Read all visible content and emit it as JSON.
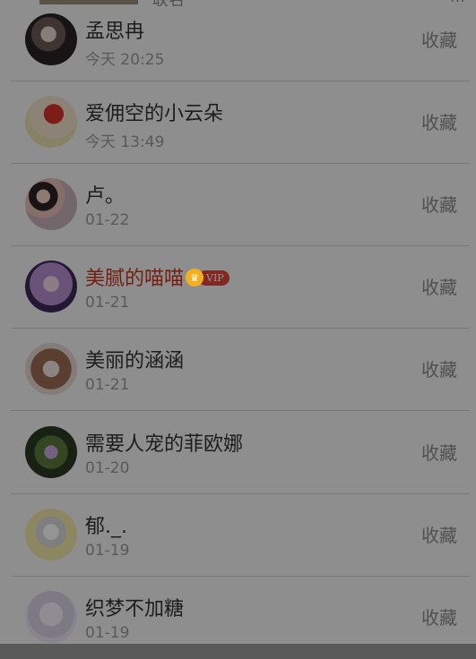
{
  "top_partial": {
    "left_text": "联名",
    "right_text": "..."
  },
  "rows": [
    {
      "name": "孟思冉",
      "time": "今天 20:25",
      "action": "收藏",
      "vip": false
    },
    {
      "name": "爱佣空的小云朵",
      "time": "今天 13:49",
      "action": "收藏",
      "vip": false
    },
    {
      "name": "卢。",
      "time": "01-22",
      "action": "收藏",
      "vip": false
    },
    {
      "name": "美腻的喵喵",
      "time": "01-21",
      "action": "收藏",
      "vip": true,
      "vip_label": "VIP"
    },
    {
      "name": "美丽的涵涵",
      "time": "01-21",
      "action": "收藏",
      "vip": false
    },
    {
      "name": "需要人宠的菲欧娜",
      "time": "01-20",
      "action": "收藏",
      "vip": false
    },
    {
      "name": "郁._.",
      "time": "01-19",
      "action": "收藏",
      "vip": false
    },
    {
      "name": "织梦不加糖",
      "time": "01-19",
      "action": "收藏",
      "vip": false
    }
  ],
  "colors": {
    "vip_name": "#c8321e",
    "vip_pill": "#e0453a",
    "vip_crown": "#f2b01e"
  },
  "icons": {
    "vip_crown": "crown-icon"
  }
}
